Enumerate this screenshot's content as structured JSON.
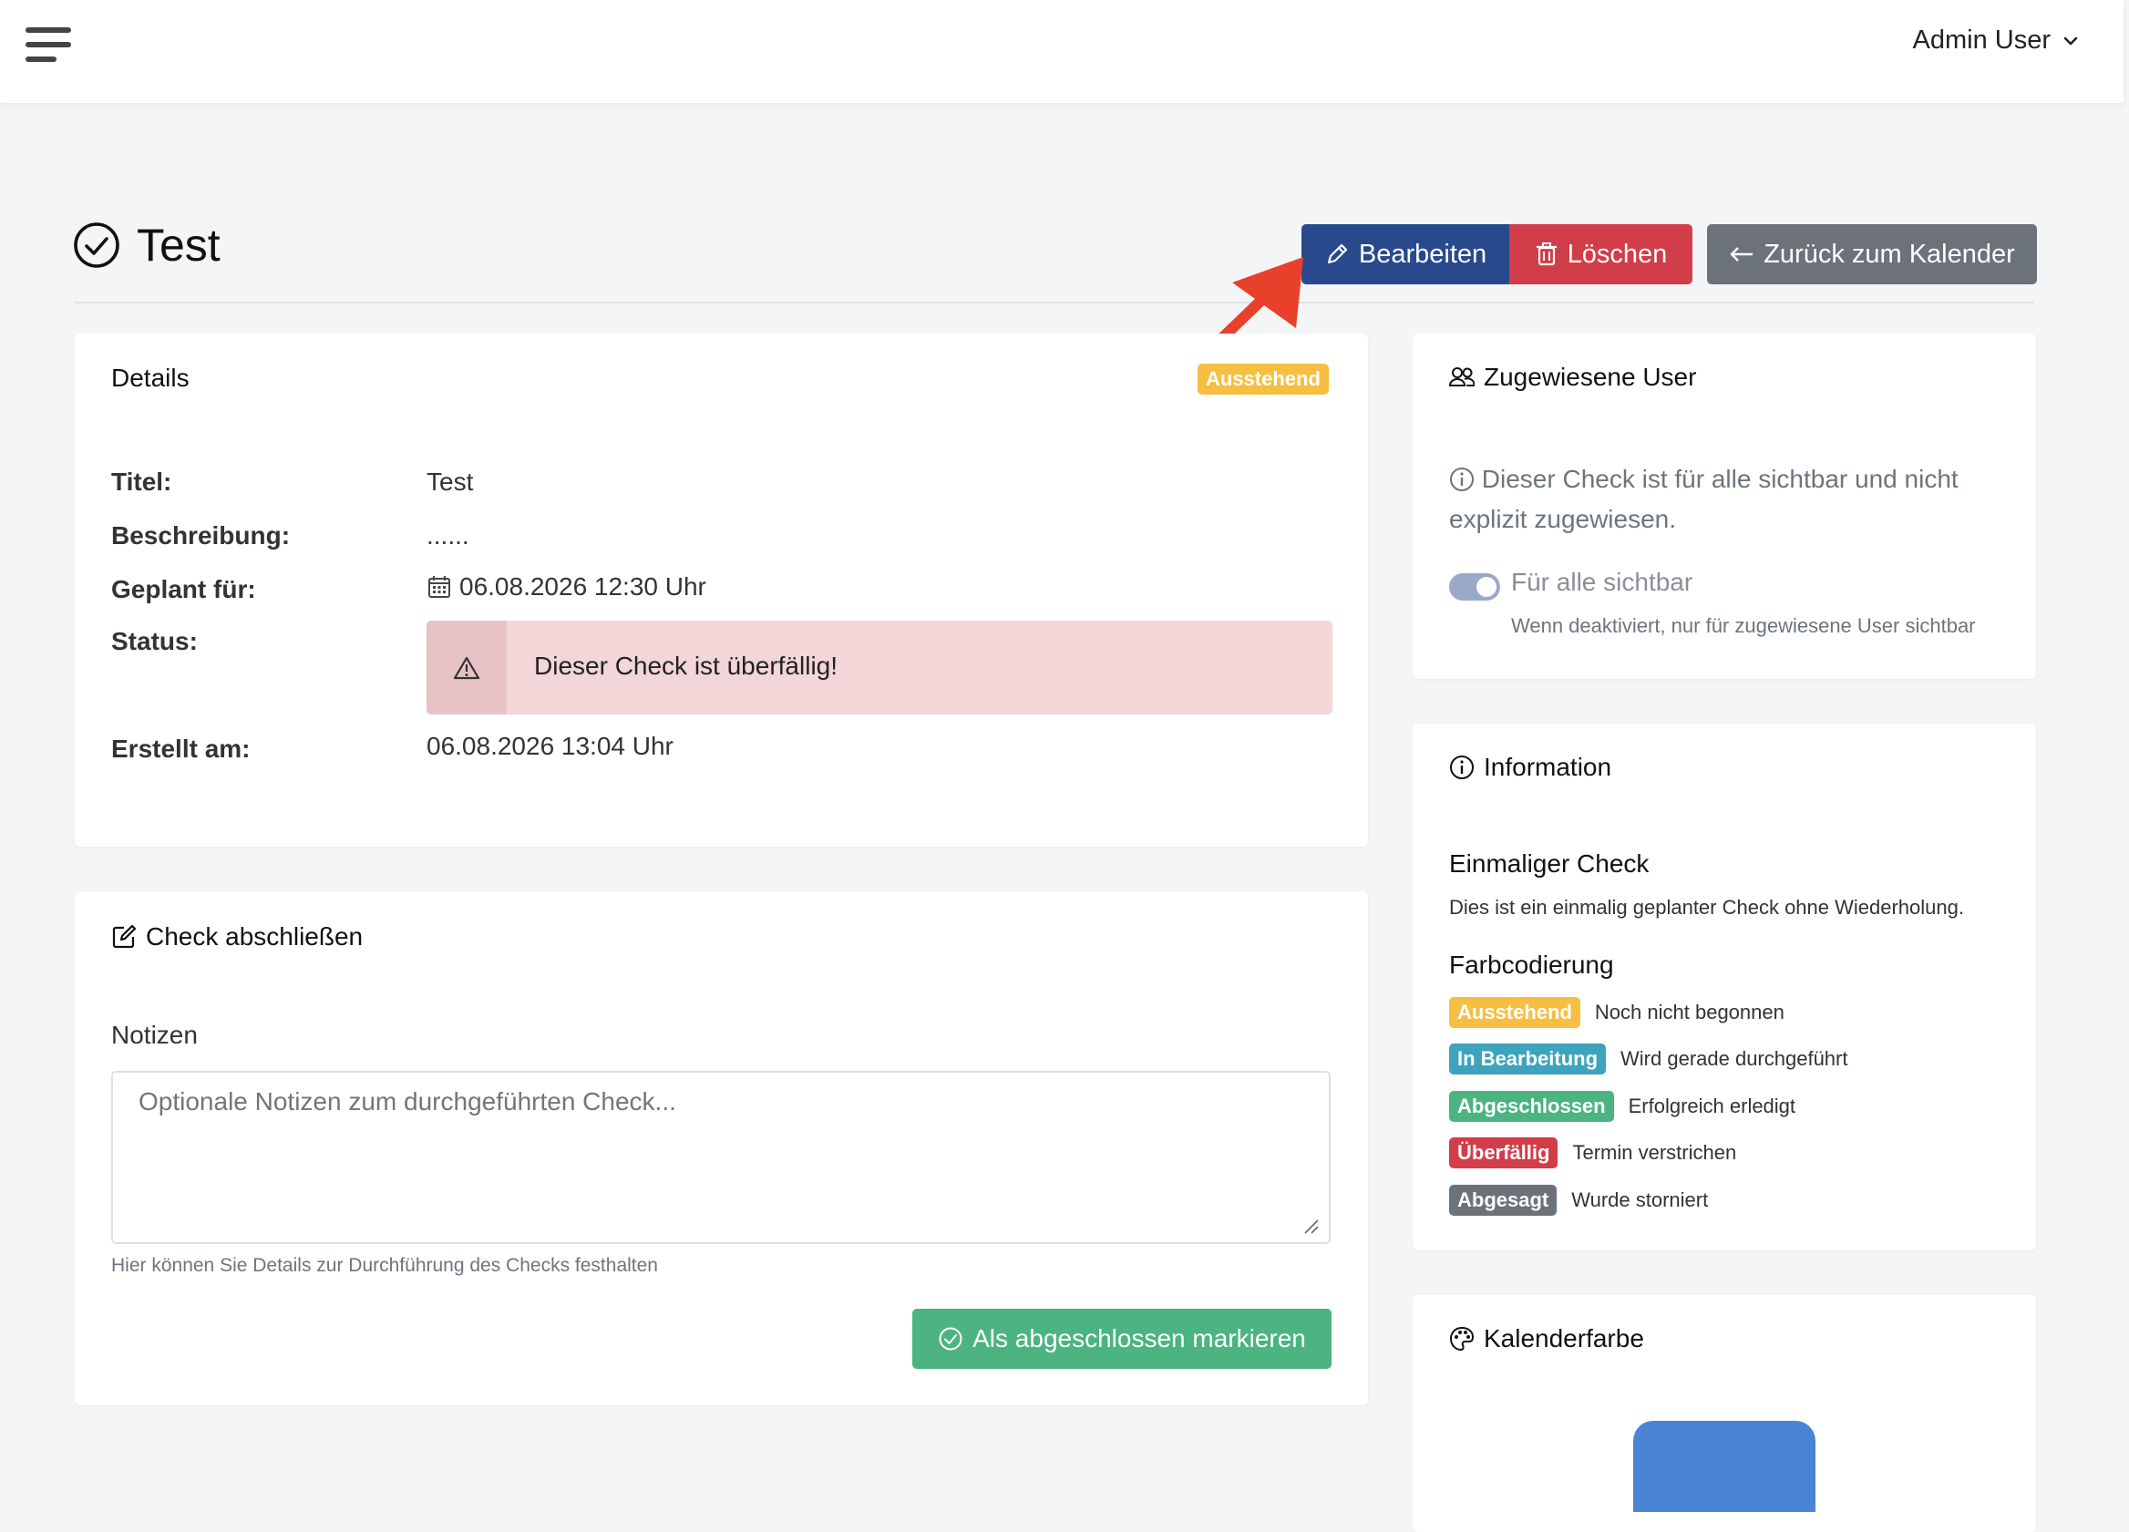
{
  "header": {
    "user_name": "Admin User"
  },
  "page": {
    "title": "Test"
  },
  "actions": {
    "edit_label": "Bearbeiten",
    "delete_label": "Löschen",
    "back_label": "Zurück zum Kalender"
  },
  "details": {
    "heading": "Details",
    "status_badge": "Ausstehend",
    "rows": {
      "title_label": "Titel:",
      "title_value": "Test",
      "description_label": "Beschreibung:",
      "description_value": "......",
      "scheduled_label": "Geplant für:",
      "scheduled_value": "06.08.2026 12:30 Uhr",
      "status_label": "Status:",
      "status_alert": "Dieser Check ist überfällig!",
      "created_label": "Erstellt am:",
      "created_value": "06.08.2026 13:04 Uhr"
    }
  },
  "complete": {
    "heading": "Check abschließen",
    "notes_label": "Notizen",
    "notes_placeholder": "Optionale Notizen zum durchgeführten Check...",
    "notes_value": "",
    "notes_help": "Hier können Sie Details zur Durchführung des Checks festhalten",
    "submit_label": "Als abgeschlossen markieren"
  },
  "assigned": {
    "heading": "Zugewiesene User",
    "info": "Dieser Check ist für alle sichtbar und nicht explizit zugewiesen.",
    "toggle_label": "Für alle sichtbar",
    "toggle_on": true,
    "toggle_help": "Wenn deaktiviert, nur für zugewiesene User sichtbar"
  },
  "information": {
    "heading": "Information",
    "type_title": "Einmaliger Check",
    "type_desc": "Dies ist ein einmalig geplanter Check ohne Wiederholung.",
    "legend_title": "Farbcodierung",
    "legend": [
      {
        "badge": "Ausstehend",
        "text": "Noch nicht begonnen",
        "color": "#f6bf42"
      },
      {
        "badge": "In Bearbeitung",
        "text": "Wird gerade durchgeführt",
        "color": "#3ea3bc"
      },
      {
        "badge": "Abgeschlossen",
        "text": "Erfolgreich erledigt",
        "color": "#4bb481"
      },
      {
        "badge": "Überfällig",
        "text": "Termin verstrichen",
        "color": "#d23d4a"
      },
      {
        "badge": "Abgesagt",
        "text": "Wurde storniert",
        "color": "#6c7279"
      }
    ]
  },
  "calendar_color": {
    "heading": "Kalenderfarbe",
    "color": "#4a84d4"
  },
  "colors": {
    "primary": "#284a8c",
    "danger": "#d23d4a",
    "secondary": "#6c7279",
    "success": "#4bb481",
    "warning": "#f6bf42"
  }
}
